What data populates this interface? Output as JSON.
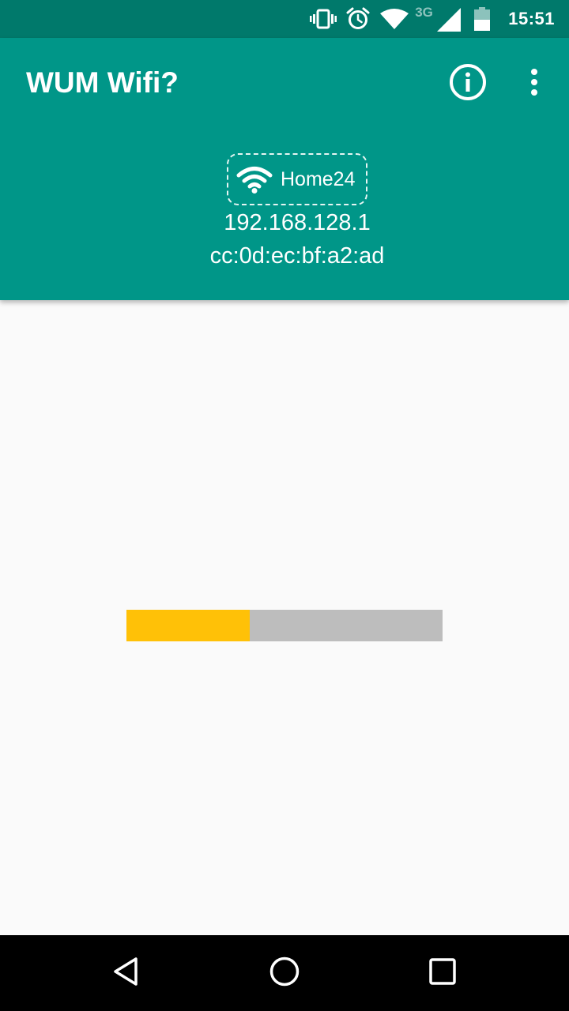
{
  "status_bar": {
    "network_type": "3G",
    "time": "15:51",
    "icons": [
      "vibrate-icon",
      "alarm-icon",
      "wifi-icon",
      "cellular-signal-icon",
      "battery-icon"
    ]
  },
  "app_bar": {
    "title": "WUM Wifi?",
    "actions": [
      "info-icon",
      "more-vert-icon"
    ],
    "network": {
      "ssid": "Home24",
      "ip": "192.168.128.1",
      "mac": "cc:0d:ec:bf:a2:ad"
    }
  },
  "progress": {
    "value": 0.39
  },
  "nav_bar": {
    "buttons": [
      "back-icon",
      "home-icon",
      "recents-icon"
    ]
  },
  "colors": {
    "status_bar": "#00796b",
    "app_bar": "#009688",
    "progress_fill": "#ffc107",
    "progress_track": "#bdbdbd",
    "background": "#fafafa"
  }
}
